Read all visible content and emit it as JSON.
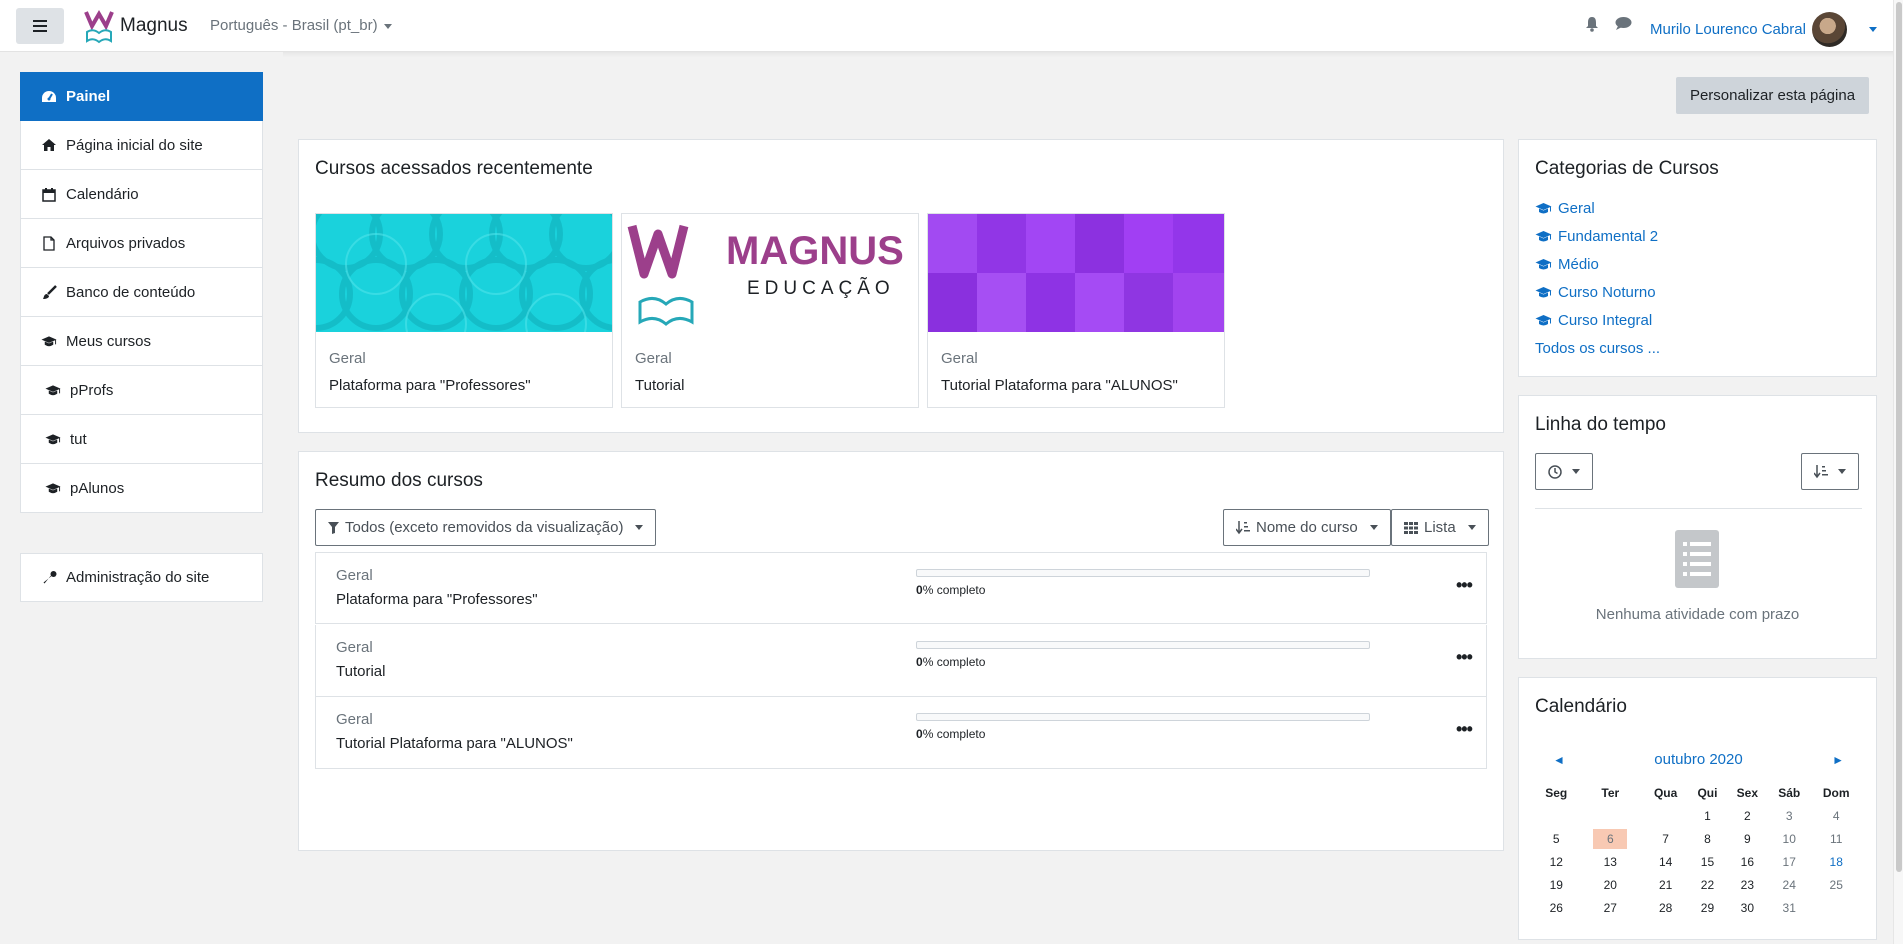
{
  "navbar": {
    "brand": "Magnus",
    "language": "Português - Brasil (pt_br)",
    "user_name": "Murilo Lourenco Cabral"
  },
  "drawer": {
    "items": [
      {
        "label": "Painel",
        "icon": "dashboard-icon"
      },
      {
        "label": "Página inicial do site",
        "icon": "home-icon"
      },
      {
        "label": "Calendário",
        "icon": "calendar-icon"
      },
      {
        "label": "Arquivos privados",
        "icon": "file-icon"
      },
      {
        "label": "Banco de conteúdo",
        "icon": "brush-icon"
      },
      {
        "label": "Meus cursos",
        "icon": "graduation-cap-icon"
      },
      {
        "label": "pProfs",
        "icon": "graduation-cap-icon"
      },
      {
        "label": "tut",
        "icon": "graduation-cap-icon"
      },
      {
        "label": "pAlunos",
        "icon": "graduation-cap-icon"
      }
    ],
    "admin": {
      "label": "Administração do site",
      "icon": "wrench-icon"
    }
  },
  "main": {
    "customize_label": "Personalizar esta página",
    "recent": {
      "title": "Cursos acessados recentemente",
      "courses": [
        {
          "category": "Geral",
          "name": "Plataforma para \"Professores\""
        },
        {
          "category": "Geral",
          "name": "Tutorial",
          "logo_main": "MAGNUS",
          "logo_sub": "EDUCAÇÃO"
        },
        {
          "category": "Geral",
          "name": "Tutorial Plataforma para \"ALUNOS\""
        }
      ]
    },
    "overview": {
      "title": "Resumo dos cursos",
      "filter_label": "Todos (exceto removidos da visualização)",
      "sort_label": "Nome do curso",
      "view_label": "Lista",
      "complete_suffix": "% completo",
      "rows": [
        {
          "category": "Geral",
          "name": "Plataforma para \"Professores\"",
          "progress": "0"
        },
        {
          "category": "Geral",
          "name": "Tutorial",
          "progress": "0"
        },
        {
          "category": "Geral",
          "name": "Tutorial Plataforma para \"ALUNOS\"",
          "progress": "0"
        }
      ]
    }
  },
  "categories": {
    "title": "Categorias de Cursos",
    "items": [
      "Geral",
      "Fundamental 2",
      "Médio",
      "Curso Noturno",
      "Curso Integral"
    ],
    "all_label": "Todos os cursos ..."
  },
  "timeline": {
    "title": "Linha do tempo",
    "empty": "Nenhuma atividade com prazo"
  },
  "calendar": {
    "title": "Calendário",
    "month": "outubro 2020",
    "prev": "◄",
    "next": "►",
    "days": [
      "Seg",
      "Ter",
      "Qua",
      "Qui",
      "Sex",
      "Sáb",
      "Dom"
    ],
    "weeks": [
      [
        "",
        "",
        "",
        "1",
        "2",
        "3",
        "4"
      ],
      [
        "5",
        "6",
        "7",
        "8",
        "9",
        "10",
        "11"
      ],
      [
        "12",
        "13",
        "14",
        "15",
        "16",
        "17",
        "18"
      ],
      [
        "19",
        "20",
        "21",
        "22",
        "23",
        "24",
        "25"
      ],
      [
        "26",
        "27",
        "28",
        "29",
        "30",
        "31",
        ""
      ]
    ],
    "today": "6",
    "event_day": "18"
  },
  "colors": {
    "primary": "#0f6fc5",
    "course1": "#1ad2dc",
    "course3": "#9b3ff0",
    "today": "#f8c9b3"
  }
}
